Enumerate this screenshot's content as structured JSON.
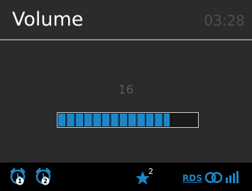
{
  "header": {
    "title": "Volume",
    "clock": "03:28"
  },
  "volume": {
    "value_label": "16",
    "level_fraction": 0.8
  },
  "statusbar": {
    "alarm1_label": "1",
    "alarm2_label": "2",
    "favorite_number": "2",
    "rds_label": "RDS",
    "icons": [
      "alarm-1-icon",
      "alarm-2-icon",
      "favorite-star-icon",
      "rds-icon",
      "stereo-icon",
      "signal-strength-icon"
    ]
  },
  "colors": {
    "accent": "#1e86c6",
    "background": "#2a2a2a",
    "statusbar": "#000000",
    "title": "#ffffff",
    "clock": "#4e4e4e"
  }
}
